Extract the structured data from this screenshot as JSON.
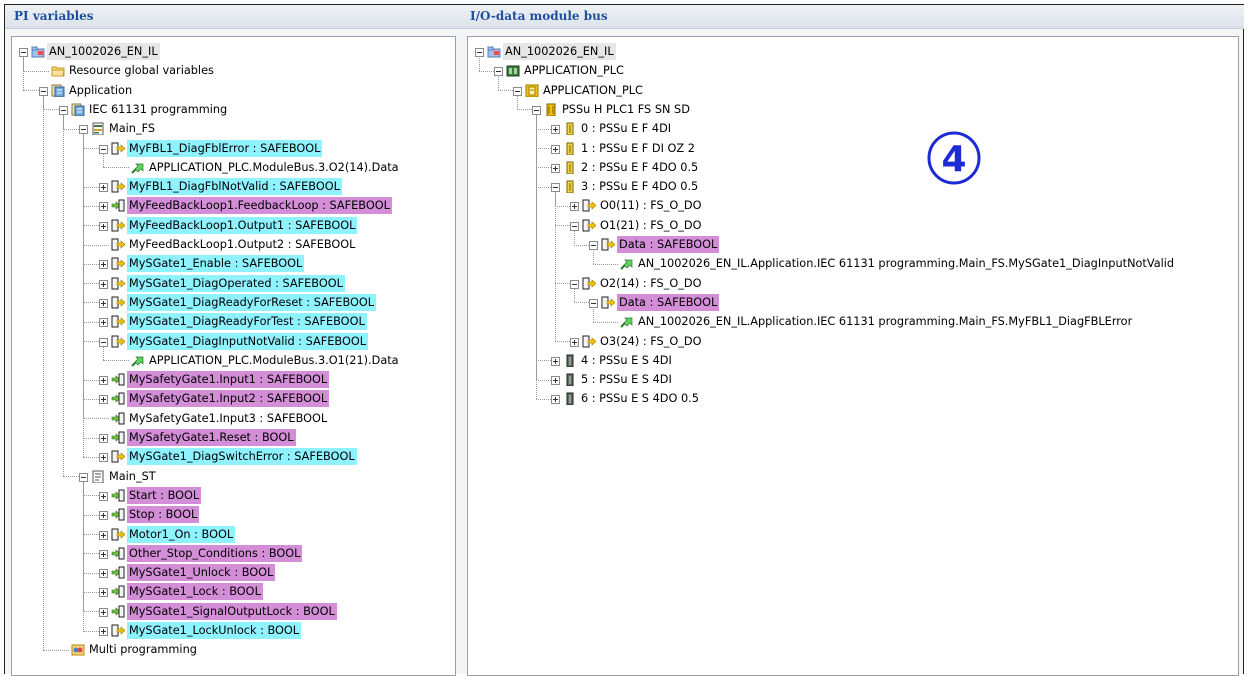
{
  "panels": {
    "pi_title": "PI variables",
    "io_title": "I/O-data module bus"
  },
  "badge": "4",
  "pi_tree": [
    {
      "level": 0,
      "icon": "project-icon",
      "label": "AN_1002026_EN_IL",
      "hl": "gray",
      "exp": "minus"
    },
    {
      "level": 1,
      "icon": "folder-icon",
      "label": "Resource global variables"
    },
    {
      "level": 1,
      "icon": "application-icon",
      "label": "Application",
      "exp": "minus"
    },
    {
      "level": 2,
      "icon": "application-icon",
      "label": "IEC 61131 programming",
      "exp": "minus"
    },
    {
      "level": 3,
      "icon": "program-icon",
      "label": "Main_FS",
      "exp": "minus"
    },
    {
      "level": 4,
      "icon": "output-var-icon",
      "label": "MyFBL1_DiagFblError : SAFEBOOL",
      "hl": "cyan",
      "exp": "minus"
    },
    {
      "level": 5,
      "icon": "link-icon",
      "label": "APPLICATION_PLC.ModuleBus.3.O2(14).Data"
    },
    {
      "level": 4,
      "icon": "output-var-icon",
      "label": "MyFBL1_DiagFblNotValid : SAFEBOOL",
      "hl": "cyan",
      "exp": "plus"
    },
    {
      "level": 4,
      "icon": "input-var-icon",
      "label": "MyFeedBackLoop1.FeedbackLoop : SAFEBOOL",
      "hl": "pink",
      "exp": "plus"
    },
    {
      "level": 4,
      "icon": "output-var-icon",
      "label": "MyFeedBackLoop1.Output1 : SAFEBOOL",
      "hl": "cyan",
      "exp": "plus"
    },
    {
      "level": 4,
      "icon": "output-var-icon",
      "label": "MyFeedBackLoop1.Output2 : SAFEBOOL"
    },
    {
      "level": 4,
      "icon": "output-var-icon",
      "label": "MySGate1_Enable : SAFEBOOL",
      "hl": "cyan",
      "exp": "plus"
    },
    {
      "level": 4,
      "icon": "output-var-icon",
      "label": "MySGate1_DiagOperated : SAFEBOOL",
      "hl": "cyan",
      "exp": "plus"
    },
    {
      "level": 4,
      "icon": "output-var-icon",
      "label": "MySGate1_DiagReadyForReset : SAFEBOOL",
      "hl": "cyan",
      "exp": "plus"
    },
    {
      "level": 4,
      "icon": "output-var-icon",
      "label": "MySGate1_DiagReadyForTest : SAFEBOOL",
      "hl": "cyan",
      "exp": "plus"
    },
    {
      "level": 4,
      "icon": "output-var-icon",
      "label": "MySGate1_DiagInputNotValid : SAFEBOOL",
      "hl": "cyan",
      "exp": "minus"
    },
    {
      "level": 5,
      "icon": "link-icon",
      "label": "APPLICATION_PLC.ModuleBus.3.O1(21).Data"
    },
    {
      "level": 4,
      "icon": "input-var-icon",
      "label": "MySafetyGate1.Input1 : SAFEBOOL",
      "hl": "pink",
      "exp": "plus"
    },
    {
      "level": 4,
      "icon": "input-var-icon",
      "label": "MySafetyGate1.Input2 : SAFEBOOL",
      "hl": "pink",
      "exp": "plus"
    },
    {
      "level": 4,
      "icon": "input-var-icon",
      "label": "MySafetyGate1.Input3 : SAFEBOOL"
    },
    {
      "level": 4,
      "icon": "input-var-icon",
      "label": "MySafetyGate1.Reset : BOOL",
      "hl": "pink",
      "exp": "plus"
    },
    {
      "level": 4,
      "icon": "output-var-icon",
      "label": "MySGate1_DiagSwitchError : SAFEBOOL",
      "hl": "cyan",
      "exp": "plus"
    },
    {
      "level": 3,
      "icon": "program-st-icon",
      "label": "Main_ST",
      "exp": "minus"
    },
    {
      "level": 4,
      "icon": "input-var-icon",
      "label": "Start : BOOL",
      "hl": "pink",
      "exp": "plus"
    },
    {
      "level": 4,
      "icon": "input-var-icon",
      "label": "Stop : BOOL",
      "hl": "pink",
      "exp": "plus"
    },
    {
      "level": 4,
      "icon": "output-var-icon",
      "label": "Motor1_On : BOOL",
      "hl": "cyan",
      "exp": "plus"
    },
    {
      "level": 4,
      "icon": "input-var-icon",
      "label": "Other_Stop_Conditions : BOOL",
      "hl": "pink",
      "exp": "plus"
    },
    {
      "level": 4,
      "icon": "input-var-icon",
      "label": "MySGate1_Unlock : BOOL",
      "hl": "pink",
      "exp": "plus"
    },
    {
      "level": 4,
      "icon": "input-var-icon",
      "label": "MySGate1_Lock : BOOL",
      "hl": "pink",
      "exp": "plus"
    },
    {
      "level": 4,
      "icon": "input-var-icon",
      "label": "MySGate1_SignalOutputLock : BOOL",
      "hl": "pink",
      "exp": "plus"
    },
    {
      "level": 4,
      "icon": "output-var-icon",
      "label": "MySGate1_LockUnlock : BOOL",
      "hl": "cyan",
      "exp": "plus"
    },
    {
      "level": 2,
      "icon": "multi-programming-icon",
      "label": "Multi programming"
    }
  ],
  "io_tree": [
    {
      "level": 0,
      "icon": "project-icon",
      "label": "AN_1002026_EN_IL",
      "hl": "gray",
      "exp": "minus"
    },
    {
      "level": 1,
      "icon": "plc-icon",
      "label": "APPLICATION_PLC",
      "exp": "minus"
    },
    {
      "level": 2,
      "icon": "plc-module-icon",
      "label": "APPLICATION_PLC",
      "exp": "minus"
    },
    {
      "level": 3,
      "icon": "head-module-icon",
      "label": "PSSu H PLC1 FS SN SD",
      "exp": "minus"
    },
    {
      "level": 4,
      "icon": "safe-module-icon",
      "label": "0 : PSSu E F 4DI",
      "exp": "plus"
    },
    {
      "level": 4,
      "icon": "safe-module-icon",
      "label": "1 : PSSu E F DI OZ 2",
      "exp": "plus"
    },
    {
      "level": 4,
      "icon": "safe-module-icon",
      "label": "2 : PSSu E F 4DO 0.5",
      "exp": "plus"
    },
    {
      "level": 4,
      "icon": "safe-module-icon",
      "label": "3 : PSSu E F 4DO 0.5",
      "exp": "minus"
    },
    {
      "level": 5,
      "icon": "output-var-icon",
      "label": "O0(11) : FS_O_DO",
      "exp": "plus"
    },
    {
      "level": 5,
      "icon": "output-var-icon",
      "label": "O1(21) : FS_O_DO",
      "exp": "minus"
    },
    {
      "level": 6,
      "icon": "output-var-icon",
      "label": "Data : SAFEBOOL",
      "hl": "pink",
      "exp": "minus"
    },
    {
      "level": 7,
      "icon": "link-icon",
      "label": "AN_1002026_EN_IL.Application.IEC 61131 programming.Main_FS.MySGate1_DiagInputNotValid"
    },
    {
      "level": 5,
      "icon": "output-var-icon",
      "label": "O2(14) : FS_O_DO",
      "exp": "minus"
    },
    {
      "level": 6,
      "icon": "output-var-icon",
      "label": "Data : SAFEBOOL",
      "hl": "pink",
      "exp": "minus"
    },
    {
      "level": 7,
      "icon": "link-icon",
      "label": "AN_1002026_EN_IL.Application.IEC 61131 programming.Main_FS.MyFBL1_DiagFBLError"
    },
    {
      "level": 5,
      "icon": "output-var-icon",
      "label": "O3(24) : FS_O_DO",
      "exp": "plus"
    },
    {
      "level": 4,
      "icon": "std-module-icon",
      "label": "4 : PSSu E S 4DI",
      "exp": "plus"
    },
    {
      "level": 4,
      "icon": "std-module-icon",
      "label": "5 : PSSu E S 4DI",
      "exp": "plus"
    },
    {
      "level": 4,
      "icon": "std-module-icon",
      "label": "6 : PSSu E S 4DO 0.5",
      "exp": "plus"
    }
  ]
}
